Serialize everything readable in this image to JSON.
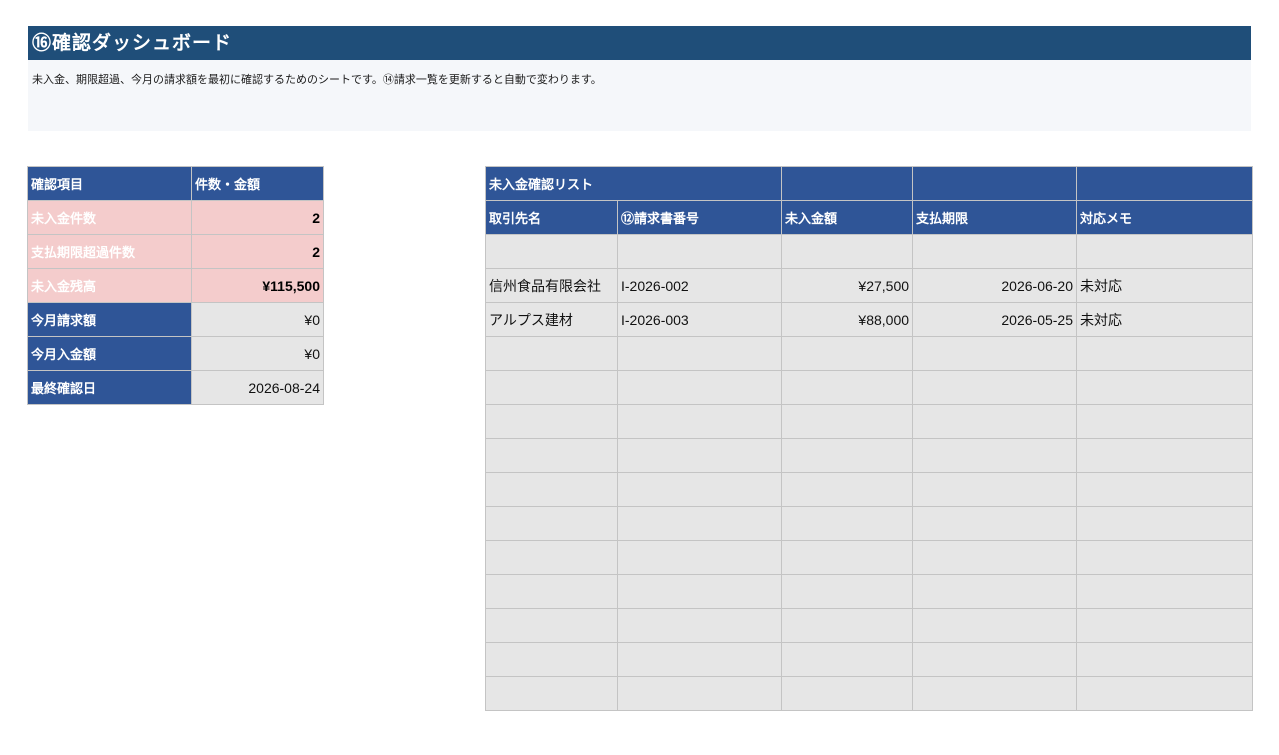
{
  "sheet": {
    "title": "⑯確認ダッシュボード",
    "description": "未入金、期限超過、今月の請求額を最初に確認するためのシートです。⑭請求一覧を更新すると自動で変わります。"
  },
  "summary": {
    "header_item": "確認項目",
    "header_value": "件数・金額",
    "rows": [
      {
        "label": "未入金件数",
        "value": "2"
      },
      {
        "label": "支払期限超過件数",
        "value": "2"
      },
      {
        "label": "未入金残高",
        "value": "¥115,500"
      },
      {
        "label": "今月請求額",
        "value": "¥0"
      },
      {
        "label": "今月入金額",
        "value": "¥0"
      },
      {
        "label": "最終確認日",
        "value": "2026-08-24"
      }
    ]
  },
  "unpaid_list": {
    "title": "未入金確認リスト",
    "columns": [
      "取引先名",
      "⑫請求書番号",
      "未入金額",
      "支払期限",
      "対応メモ"
    ],
    "rows": [
      {
        "client": "",
        "invoice_no": "",
        "amount": "",
        "due": "",
        "memo": ""
      },
      {
        "client": "信州食品有限会社",
        "invoice_no": "I-2026-002",
        "amount": "¥27,500",
        "due": "2026-06-20",
        "memo": "未対応"
      },
      {
        "client": "アルプス建材",
        "invoice_no": "I-2026-003",
        "amount": "¥88,000",
        "due": "2026-05-25",
        "memo": "未対応"
      }
    ],
    "empty_rows": 11
  },
  "colors": {
    "title_bar": "#1f4e79",
    "header": "#2f5597",
    "highlight": "#f4cccc",
    "cell": "#e6e6e6"
  }
}
